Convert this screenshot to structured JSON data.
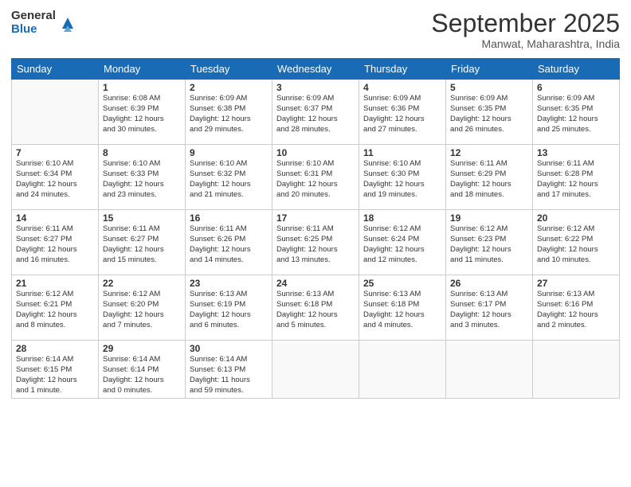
{
  "logo": {
    "general": "General",
    "blue": "Blue"
  },
  "header": {
    "month": "September 2025",
    "location": "Manwat, Maharashtra, India"
  },
  "weekdays": [
    "Sunday",
    "Monday",
    "Tuesday",
    "Wednesday",
    "Thursday",
    "Friday",
    "Saturday"
  ],
  "weeks": [
    [
      {
        "day": "",
        "info": ""
      },
      {
        "day": "1",
        "info": "Sunrise: 6:08 AM\nSunset: 6:39 PM\nDaylight: 12 hours\nand 30 minutes."
      },
      {
        "day": "2",
        "info": "Sunrise: 6:09 AM\nSunset: 6:38 PM\nDaylight: 12 hours\nand 29 minutes."
      },
      {
        "day": "3",
        "info": "Sunrise: 6:09 AM\nSunset: 6:37 PM\nDaylight: 12 hours\nand 28 minutes."
      },
      {
        "day": "4",
        "info": "Sunrise: 6:09 AM\nSunset: 6:36 PM\nDaylight: 12 hours\nand 27 minutes."
      },
      {
        "day": "5",
        "info": "Sunrise: 6:09 AM\nSunset: 6:35 PM\nDaylight: 12 hours\nand 26 minutes."
      },
      {
        "day": "6",
        "info": "Sunrise: 6:09 AM\nSunset: 6:35 PM\nDaylight: 12 hours\nand 25 minutes."
      }
    ],
    [
      {
        "day": "7",
        "info": "Sunrise: 6:10 AM\nSunset: 6:34 PM\nDaylight: 12 hours\nand 24 minutes."
      },
      {
        "day": "8",
        "info": "Sunrise: 6:10 AM\nSunset: 6:33 PM\nDaylight: 12 hours\nand 23 minutes."
      },
      {
        "day": "9",
        "info": "Sunrise: 6:10 AM\nSunset: 6:32 PM\nDaylight: 12 hours\nand 21 minutes."
      },
      {
        "day": "10",
        "info": "Sunrise: 6:10 AM\nSunset: 6:31 PM\nDaylight: 12 hours\nand 20 minutes."
      },
      {
        "day": "11",
        "info": "Sunrise: 6:10 AM\nSunset: 6:30 PM\nDaylight: 12 hours\nand 19 minutes."
      },
      {
        "day": "12",
        "info": "Sunrise: 6:11 AM\nSunset: 6:29 PM\nDaylight: 12 hours\nand 18 minutes."
      },
      {
        "day": "13",
        "info": "Sunrise: 6:11 AM\nSunset: 6:28 PM\nDaylight: 12 hours\nand 17 minutes."
      }
    ],
    [
      {
        "day": "14",
        "info": "Sunrise: 6:11 AM\nSunset: 6:27 PM\nDaylight: 12 hours\nand 16 minutes."
      },
      {
        "day": "15",
        "info": "Sunrise: 6:11 AM\nSunset: 6:27 PM\nDaylight: 12 hours\nand 15 minutes."
      },
      {
        "day": "16",
        "info": "Sunrise: 6:11 AM\nSunset: 6:26 PM\nDaylight: 12 hours\nand 14 minutes."
      },
      {
        "day": "17",
        "info": "Sunrise: 6:11 AM\nSunset: 6:25 PM\nDaylight: 12 hours\nand 13 minutes."
      },
      {
        "day": "18",
        "info": "Sunrise: 6:12 AM\nSunset: 6:24 PM\nDaylight: 12 hours\nand 12 minutes."
      },
      {
        "day": "19",
        "info": "Sunrise: 6:12 AM\nSunset: 6:23 PM\nDaylight: 12 hours\nand 11 minutes."
      },
      {
        "day": "20",
        "info": "Sunrise: 6:12 AM\nSunset: 6:22 PM\nDaylight: 12 hours\nand 10 minutes."
      }
    ],
    [
      {
        "day": "21",
        "info": "Sunrise: 6:12 AM\nSunset: 6:21 PM\nDaylight: 12 hours\nand 8 minutes."
      },
      {
        "day": "22",
        "info": "Sunrise: 6:12 AM\nSunset: 6:20 PM\nDaylight: 12 hours\nand 7 minutes."
      },
      {
        "day": "23",
        "info": "Sunrise: 6:13 AM\nSunset: 6:19 PM\nDaylight: 12 hours\nand 6 minutes."
      },
      {
        "day": "24",
        "info": "Sunrise: 6:13 AM\nSunset: 6:18 PM\nDaylight: 12 hours\nand 5 minutes."
      },
      {
        "day": "25",
        "info": "Sunrise: 6:13 AM\nSunset: 6:18 PM\nDaylight: 12 hours\nand 4 minutes."
      },
      {
        "day": "26",
        "info": "Sunrise: 6:13 AM\nSunset: 6:17 PM\nDaylight: 12 hours\nand 3 minutes."
      },
      {
        "day": "27",
        "info": "Sunrise: 6:13 AM\nSunset: 6:16 PM\nDaylight: 12 hours\nand 2 minutes."
      }
    ],
    [
      {
        "day": "28",
        "info": "Sunrise: 6:14 AM\nSunset: 6:15 PM\nDaylight: 12 hours\nand 1 minute."
      },
      {
        "day": "29",
        "info": "Sunrise: 6:14 AM\nSunset: 6:14 PM\nDaylight: 12 hours\nand 0 minutes."
      },
      {
        "day": "30",
        "info": "Sunrise: 6:14 AM\nSunset: 6:13 PM\nDaylight: 11 hours\nand 59 minutes."
      },
      {
        "day": "",
        "info": ""
      },
      {
        "day": "",
        "info": ""
      },
      {
        "day": "",
        "info": ""
      },
      {
        "day": "",
        "info": ""
      }
    ]
  ]
}
